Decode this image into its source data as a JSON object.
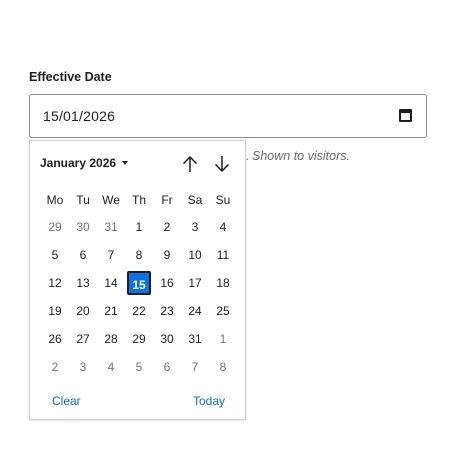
{
  "field": {
    "label": "Effective Date",
    "value": "15/01/2026",
    "hint": "Shown to visitors.",
    "hint_clipped_prefix": "."
  },
  "calendar": {
    "month_label": "January 2026",
    "weekdays": [
      "Mo",
      "Tu",
      "We",
      "Th",
      "Fr",
      "Sa",
      "Su"
    ],
    "weeks": [
      [
        {
          "d": "29",
          "o": true
        },
        {
          "d": "30",
          "o": true
        },
        {
          "d": "31",
          "o": true
        },
        {
          "d": "1"
        },
        {
          "d": "2"
        },
        {
          "d": "3"
        },
        {
          "d": "4"
        }
      ],
      [
        {
          "d": "5"
        },
        {
          "d": "6"
        },
        {
          "d": "7"
        },
        {
          "d": "8"
        },
        {
          "d": "9"
        },
        {
          "d": "10"
        },
        {
          "d": "11"
        }
      ],
      [
        {
          "d": "12"
        },
        {
          "d": "13"
        },
        {
          "d": "14"
        },
        {
          "d": "15",
          "s": true
        },
        {
          "d": "16"
        },
        {
          "d": "17"
        },
        {
          "d": "18"
        }
      ],
      [
        {
          "d": "19"
        },
        {
          "d": "20"
        },
        {
          "d": "21"
        },
        {
          "d": "22"
        },
        {
          "d": "23"
        },
        {
          "d": "24"
        },
        {
          "d": "25"
        }
      ],
      [
        {
          "d": "26"
        },
        {
          "d": "27"
        },
        {
          "d": "28"
        },
        {
          "d": "29"
        },
        {
          "d": "30"
        },
        {
          "d": "31"
        },
        {
          "d": "1",
          "o": true
        }
      ],
      [
        {
          "d": "2",
          "o": true
        },
        {
          "d": "3",
          "o": true
        },
        {
          "d": "4",
          "o": true
        },
        {
          "d": "5",
          "o": true
        },
        {
          "d": "6",
          "o": true
        },
        {
          "d": "7",
          "o": true
        },
        {
          "d": "8",
          "o": true
        }
      ]
    ],
    "clear_label": "Clear",
    "today_label": "Today"
  },
  "colors": {
    "accent": "#0a72e6",
    "link": "#0a72c6"
  },
  "icons": {
    "input_icon": "calendar-icon",
    "prev": "arrow-up-icon",
    "next": "arrow-down-icon"
  }
}
